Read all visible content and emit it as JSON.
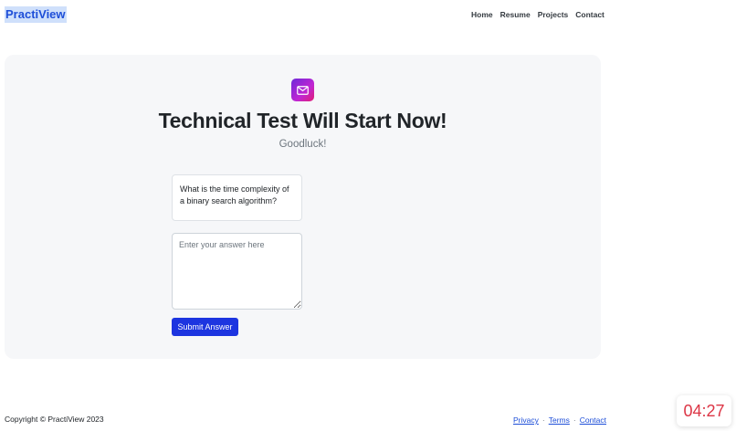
{
  "header": {
    "logo": "PractiView",
    "nav": [
      "Home",
      "Resume",
      "Projects",
      "Contact"
    ]
  },
  "main": {
    "icon": "mail-icon",
    "title": "Technical Test Will Start Now!",
    "subtitle": "Goodluck!",
    "question": "What is the time complexity of a binary search algorithm?",
    "answer_value": "",
    "answer_placeholder": "Enter your answer here",
    "submit_label": "Submit Answer"
  },
  "footer": {
    "copyright": "Copyright © PractiView 2023",
    "links": [
      "Privacy",
      "Terms",
      "Contact"
    ]
  },
  "timer": "04:27",
  "colors": {
    "brand": "#1d4ed8",
    "button": "#1d35e0",
    "timer": "#dc3545",
    "icon_gradient_start": "#6d28d9",
    "icon_gradient_end": "#e11d74"
  }
}
